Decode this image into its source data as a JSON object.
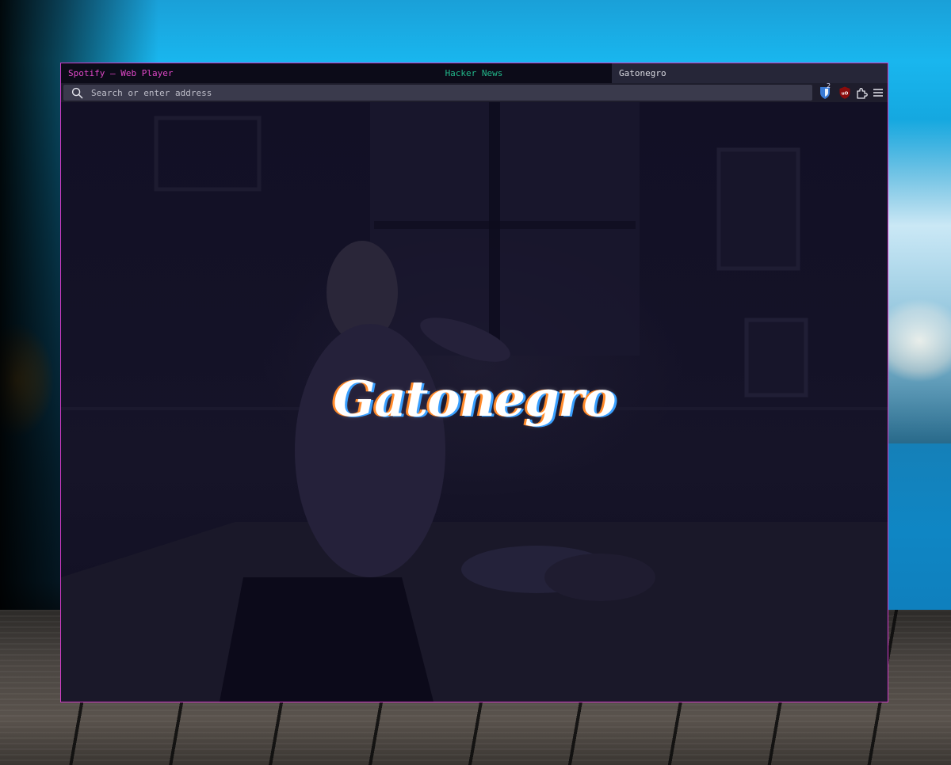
{
  "browser": {
    "tabs": [
      {
        "label": "Spotify – Web Player",
        "color": "#e048c8",
        "active": false
      },
      {
        "label": "Hacker News",
        "color": "#22b78a",
        "active": false
      },
      {
        "label": "Gatonegro",
        "color": "#d8d8df",
        "active": true
      }
    ],
    "urlbar": {
      "placeholder": "Search or enter address",
      "icon": "search-icon"
    },
    "extensions": [
      {
        "name": "bitwarden-icon",
        "badge": "2"
      },
      {
        "name": "ublock-origin-icon",
        "label": "uO"
      },
      {
        "name": "extensions-puzzle-icon"
      },
      {
        "name": "hamburger-menu-icon"
      }
    ],
    "accent_border": "#d23bc8"
  },
  "page": {
    "logo_text": "Gatonegro"
  }
}
